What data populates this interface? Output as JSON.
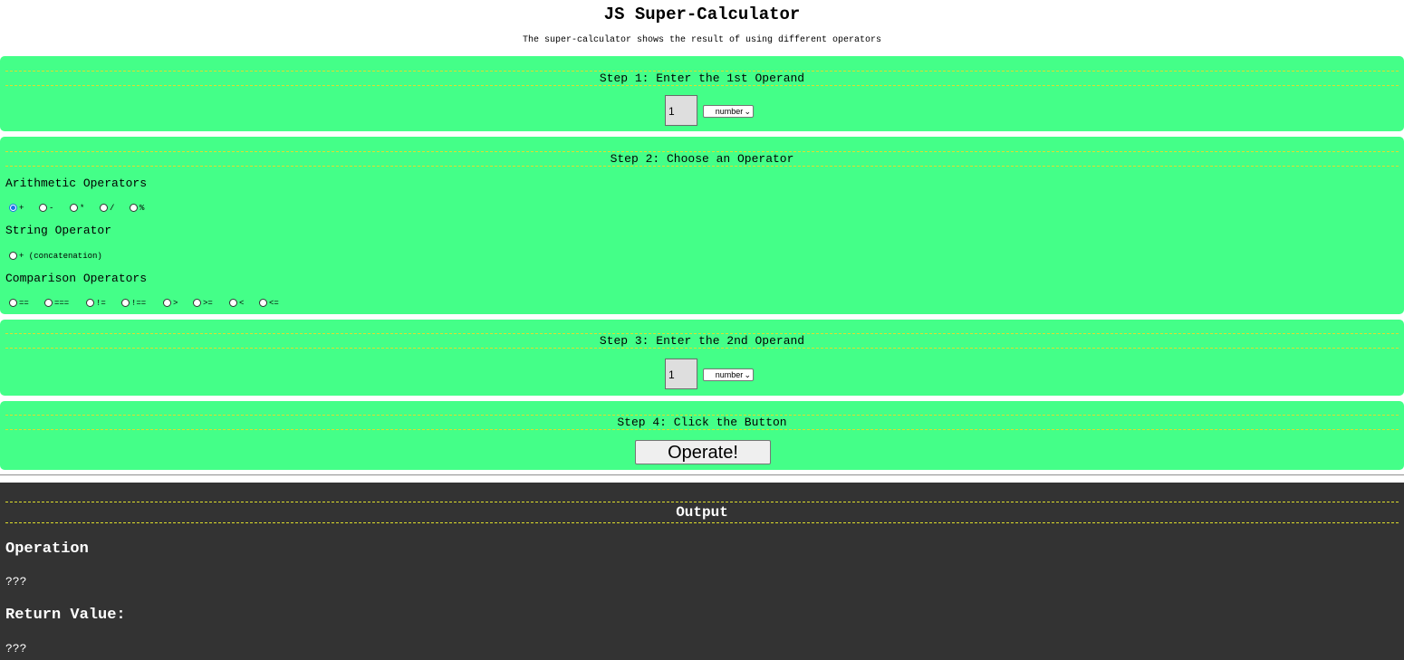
{
  "page": {
    "title": "JS Super-Calculator",
    "subtitle": "The super-calculator shows the result of using different operators"
  },
  "step1": {
    "heading": "Step 1: Enter the 1st Operand",
    "operand_value": "1",
    "type_selected": "number"
  },
  "step2": {
    "heading": "Step 2: Choose an Operator",
    "arithmetic": {
      "label": "Arithmetic Operators",
      "options": [
        "+",
        "-",
        "*",
        "/",
        "%"
      ],
      "selected": "+"
    },
    "string": {
      "label": "String Operator",
      "options": [
        "+ (concatenation)"
      ]
    },
    "comparison": {
      "label": "Comparison Operators",
      "options": [
        "==",
        "===",
        "!=",
        "!==",
        ">",
        ">=",
        "<",
        "<="
      ]
    }
  },
  "step3": {
    "heading": "Step 3: Enter the 2nd Operand",
    "operand_value": "1",
    "type_selected": "number"
  },
  "step4": {
    "heading": "Step 4: Click the Button",
    "button_label": "Operate!"
  },
  "output": {
    "heading": "Output",
    "operation_label": "Operation",
    "operation_value": "???",
    "return_label": "Return Value:",
    "return_value": "???"
  },
  "colors": {
    "panel_bg": "#44ff88",
    "output_bg": "#333333",
    "dashed_rule": "#dede2c",
    "radio_accent": "#1a73e8"
  }
}
